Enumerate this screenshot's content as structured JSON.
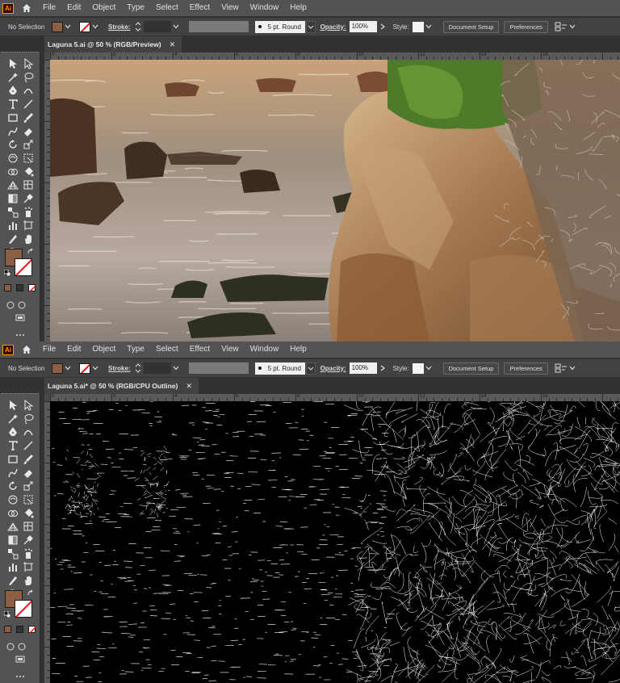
{
  "app": {
    "logo_text": "Ai"
  },
  "menu": [
    "File",
    "Edit",
    "Object",
    "Type",
    "Select",
    "Effect",
    "View",
    "Window",
    "Help"
  ],
  "control": {
    "selection_state": "No Selection",
    "stroke_label": "Stroke:",
    "brush": "5 pt. Round",
    "opacity_label": "Opacity:",
    "opacity_value": "100%",
    "style_label": "Style:",
    "document_setup": "Document Setup",
    "preferences": "Preferences"
  },
  "documents": [
    {
      "title": "Laguna 5.ai @ 50 % (RGB/Preview)",
      "close": "✕"
    },
    {
      "title": "Laguna 5.ai* @ 50 % (RGB/CPU Outline)",
      "close": "✕"
    }
  ],
  "colors": {
    "fill": "#8b5f43",
    "stroke": "#ffffff",
    "none_slash": "#e01111",
    "ui_dark": "#323232",
    "ui_panel": "#535353"
  },
  "ruler": {
    "h_labels": [
      "0",
      "2",
      "4",
      "6",
      "8",
      "10",
      "12",
      "14",
      "16"
    ]
  },
  "tools": [
    "selection-tool",
    "direct-selection-tool",
    "magic-wand-tool",
    "lasso-tool",
    "pen-tool",
    "curvature-tool",
    "type-tool",
    "line-segment-tool",
    "rectangle-tool",
    "paintbrush-tool",
    "shaper-tool",
    "eraser-tool",
    "rotate-tool",
    "scale-tool",
    "warp-tool",
    "free-transform-tool",
    "shape-builder-tool",
    "live-paint-bucket-tool",
    "perspective-grid-tool",
    "mesh-tool",
    "gradient-tool",
    "eyedropper-tool",
    "blend-tool",
    "symbol-sprayer-tool",
    "column-graph-tool",
    "artboard-tool",
    "slice-tool",
    "hand-tool",
    "zoom-tool"
  ]
}
